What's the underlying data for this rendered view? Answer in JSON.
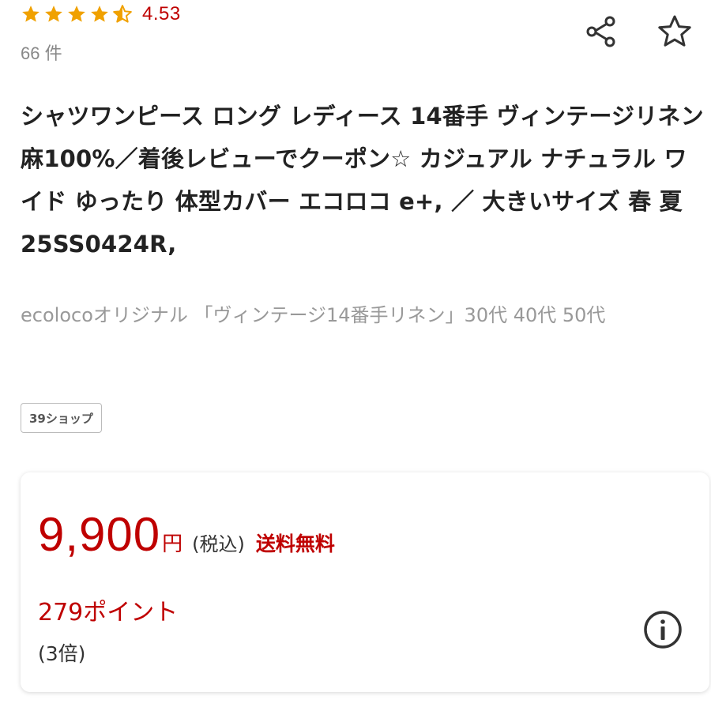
{
  "rating": {
    "value": "4.53",
    "stars_filled": 4.5,
    "stars_max": 5,
    "review_count": "66 件"
  },
  "actions": {
    "share_icon": "share-icon",
    "favorite_icon": "star-outline-icon"
  },
  "product": {
    "title": "シャツワンピース ロング レディース 14番手 ヴィンテージリネン 麻100%／着後レビューでクーポン☆ カジュアル ナチュラル ワイド ゆったり 体型カバー エコロコ e+, ／ 大きいサイズ 春 夏 25SS0424R,",
    "subtitle": "ecolocoオリジナル 「ヴィンテージ14番手リネン」30代 40代 50代",
    "shop_badge": "39ショップ"
  },
  "price": {
    "value": "9,900",
    "unit": "円",
    "tax_label": "(税込)",
    "shipping_label": "送料無料",
    "points": "279ポイント",
    "points_multiplier": "(3倍)",
    "info_icon": "info-icon"
  },
  "colors": {
    "star": "#f0a100",
    "accent_red": "#bf0000",
    "text": "#222222",
    "muted": "#999999",
    "icon": "#333333"
  }
}
